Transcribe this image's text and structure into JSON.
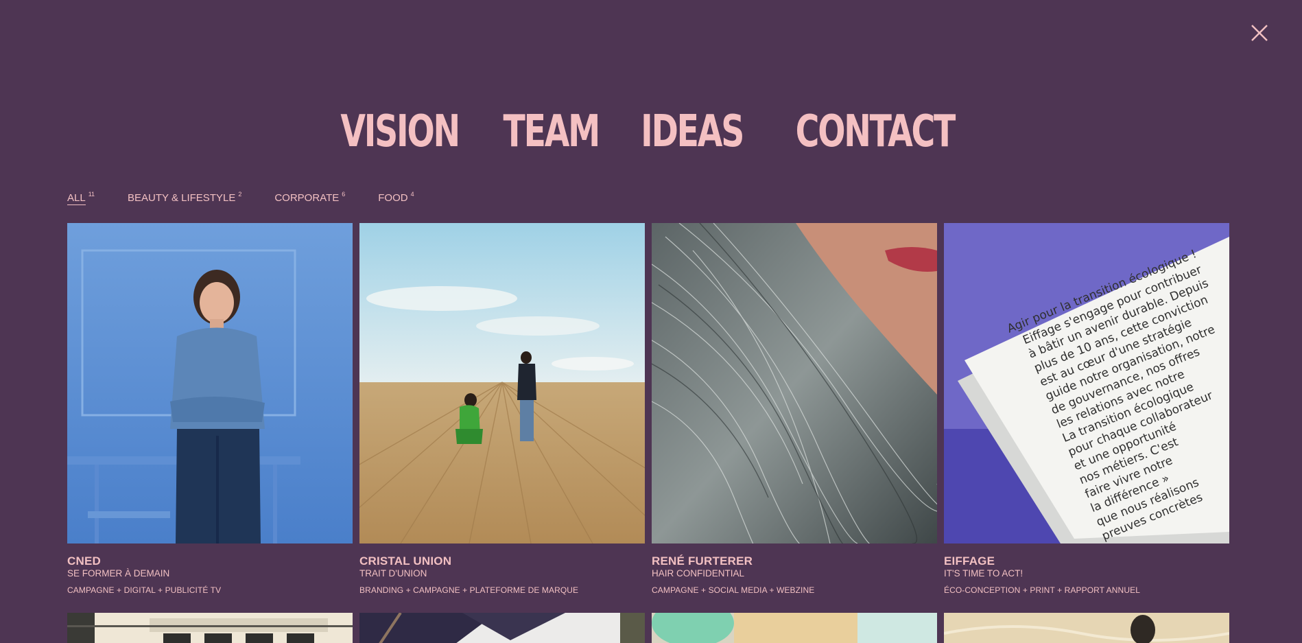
{
  "close_icon": "close-icon",
  "nav": {
    "items": [
      "VISION",
      "TEAM",
      "IDEAS",
      "CONTACT"
    ]
  },
  "filters": [
    {
      "label": "ALL",
      "count": "11",
      "active": true
    },
    {
      "label": "BEAUTY & LIFESTYLE",
      "count": "2",
      "active": false
    },
    {
      "label": "CORPORATE",
      "count": "6",
      "active": false
    },
    {
      "label": "FOOD",
      "count": "4",
      "active": false
    }
  ],
  "projects": [
    {
      "title": "CNED",
      "subtitle": "SE FORMER À DEMAIN",
      "tags": "CAMPAGNE + DIGITAL + PUBLICITÉ TV",
      "image": "woman in blue classroom"
    },
    {
      "title": "CRISTAL UNION",
      "subtitle": "TRAIT D'UNION",
      "tags": "BRANDING + CAMPAGNE + PLATEFORME DE MARQUE",
      "image": "two men in plowed field"
    },
    {
      "title": "RENÉ FURTERER",
      "subtitle": "HAIR CONFIDENTIAL",
      "tags": "CAMPAGNE + SOCIAL MEDIA + WEBZINE",
      "image": "grey hair close-up"
    },
    {
      "title": "EIFFAGE",
      "subtitle": "IT'S TIME TO ACT!",
      "tags": "ÉCO-CONCEPTION + PRINT + RAPPORT ANNUEL",
      "image": "printed report on purple background"
    }
  ],
  "book_text": [
    "Agir pour la transition écologique !",
    "Eiffage s'engage pour contribuer",
    "à bâtir un avenir durable. Depuis",
    "plus de 10 ans, cette conviction",
    "est au cœur d'une stratégie",
    "guide notre organisation, notre",
    "de gouvernance, nos offres",
    "les relations avec notre",
    "La transition écologique",
    "pour chaque collaborateur",
    "et une opportunité",
    "nos métiers. C'est",
    "faire vivre notre",
    "la différence »",
    "que nous réalisons",
    "preuves concrètes"
  ],
  "colors": {
    "background": "#4e3553",
    "accent": "#f2c0c2"
  }
}
